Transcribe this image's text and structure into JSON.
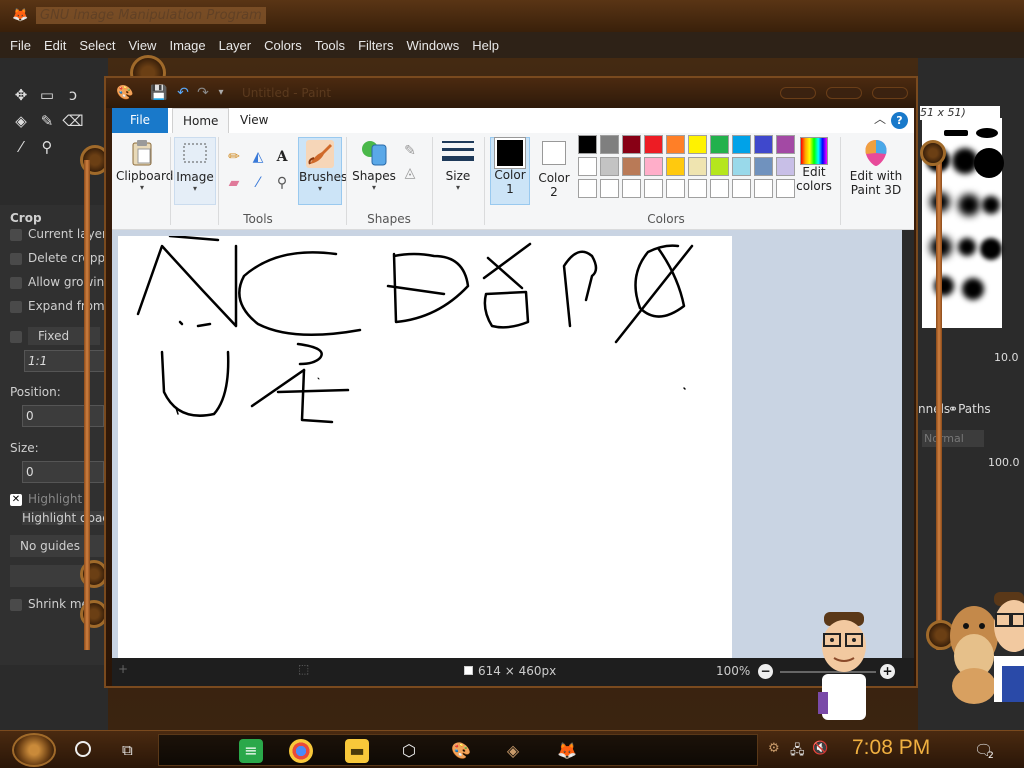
{
  "gimp": {
    "title": "GNU Image Manipulation Program",
    "menu": [
      "File",
      "Edit",
      "Select",
      "View",
      "Image",
      "Layer",
      "Colors",
      "Tools",
      "Filters",
      "Windows",
      "Help"
    ],
    "tool_options": {
      "title": "Crop",
      "current_layer": "Current layer o",
      "delete_cropped": "Delete croppe",
      "allow_growing": "Allow growing",
      "expand_from": "Expand from c",
      "fixed": "Fixed",
      "ratio": "1:1",
      "position_label": "Position:",
      "position_value": "0",
      "size_label": "Size:",
      "size_value": "0",
      "highlight": "Highlight",
      "highlight_opacity": "Highlight opacit",
      "guides": "No guides",
      "shrink": "Shrink mer",
      "a_button": "A"
    },
    "right": {
      "brush_name": "51 x 51)",
      "spacing_value": "10.0",
      "paths_tab": "Paths",
      "channels_tab": "nnels",
      "mode": "Normal",
      "opacity": "100.0"
    }
  },
  "paint": {
    "title": "Untitled - Paint",
    "tabs": {
      "file": "File",
      "home": "Home",
      "view": "View"
    },
    "groups": {
      "clipboard": "Clipboard",
      "image": "Image",
      "tools": "Tools",
      "brushes": "Brushes",
      "shapes": "Shapes",
      "size": "Size",
      "color1": "Color\n1",
      "color1_a": "Color",
      "color1_b": "1",
      "color2_a": "Color",
      "color2_b": "2",
      "colors": "Colors",
      "edit_colors_a": "Edit",
      "edit_colors_b": "colors",
      "paint3d_a": "Edit with",
      "paint3d_b": "Paint 3D"
    },
    "palette": [
      "#000000",
      "#7f7f7f",
      "#880015",
      "#ed1c24",
      "#ff7f27",
      "#fff200",
      "#22b14c",
      "#00a2e8",
      "#3f48cc",
      "#a349a4",
      "#ffffff",
      "#c3c3c3",
      "#b97a57",
      "#ffaec9",
      "#ffc90e",
      "#efe4b0",
      "#b5e61d",
      "#99d9ea",
      "#7092be",
      "#c8bfe7",
      "#ffffff",
      "#ffffff",
      "#ffffff",
      "#ffffff",
      "#ffffff",
      "#ffffff",
      "#ffffff",
      "#ffffff",
      "#ffffff",
      "#ffffff"
    ],
    "status": {
      "size": "614 × 460px",
      "zoom": "100%"
    }
  },
  "taskbar": {
    "clock": "7:08 PM",
    "notifications": "2"
  }
}
